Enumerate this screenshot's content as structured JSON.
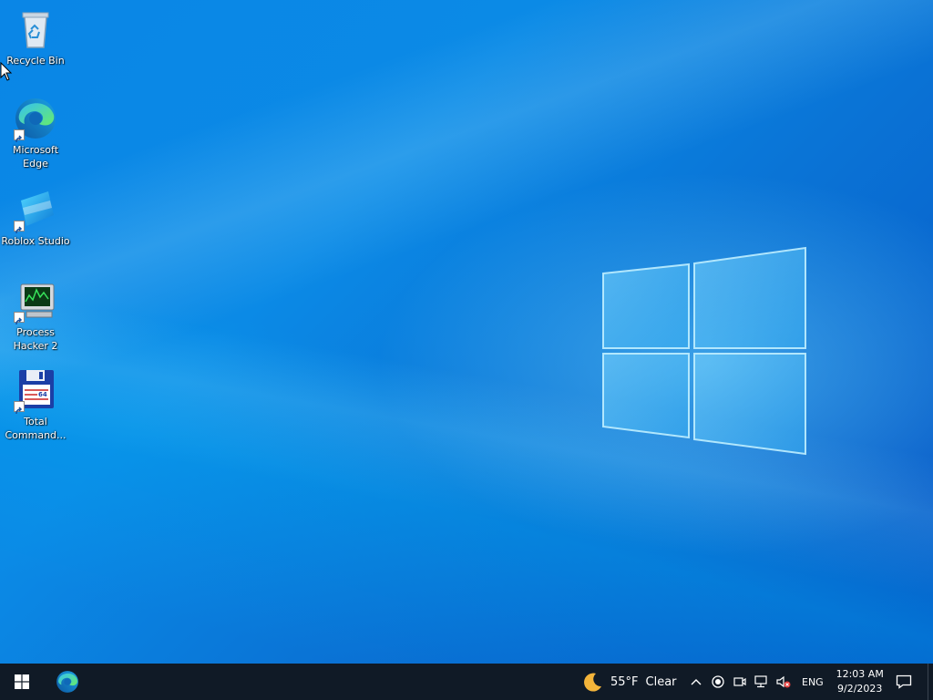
{
  "desktop": {
    "icons": [
      {
        "label": "Recycle Bin",
        "icon": "recycle-bin-icon"
      },
      {
        "label": "Microsoft Edge",
        "icon": "edge-icon"
      },
      {
        "label": "Roblox Studio",
        "icon": "roblox-studio-icon"
      },
      {
        "label": "Process Hacker 2",
        "icon": "process-hacker-icon"
      },
      {
        "label": "Total Command...",
        "icon": "total-commander-icon"
      }
    ],
    "wallpaper_colors": {
      "light": "#3fc3ff",
      "mid": "#0a86e6",
      "dark": "#0654c4"
    }
  },
  "taskbar": {
    "background": "#101a26",
    "start_icon": "windows-start-icon",
    "pinned": [
      {
        "icon": "edge-icon",
        "name": "Microsoft Edge"
      }
    ],
    "weather": {
      "icon": "moon-icon",
      "temp": "55°F",
      "condition": "Clear"
    },
    "tray": {
      "icons": [
        "chevron-up-icon",
        "record-icon",
        "meet-now-icon",
        "network-icon",
        "volume-muted-icon"
      ],
      "language": "ENG",
      "time": "12:03 AM",
      "date": "9/2/2023",
      "notification_icon": "action-center-icon"
    }
  }
}
